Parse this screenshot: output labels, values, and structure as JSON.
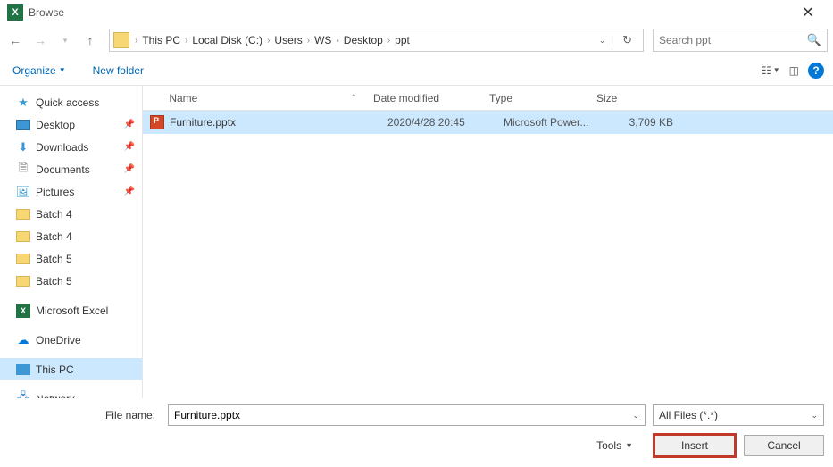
{
  "titlebar": {
    "title": "Browse"
  },
  "breadcrumb": {
    "items": [
      "This PC",
      "Local Disk (C:)",
      "Users",
      "WS",
      "Desktop",
      "ppt"
    ]
  },
  "search": {
    "placeholder": "Search ppt"
  },
  "toolbar": {
    "organize": "Organize",
    "new_folder": "New folder"
  },
  "sidebar": {
    "quick_access": "Quick access",
    "desktop": "Desktop",
    "downloads": "Downloads",
    "documents": "Documents",
    "pictures": "Pictures",
    "batch4a": "Batch 4",
    "batch4b": "Batch 4",
    "batch5a": "Batch 5",
    "batch5b": "Batch 5",
    "excel": "Microsoft Excel",
    "onedrive": "OneDrive",
    "thispc": "This PC",
    "network": "Network"
  },
  "columns": {
    "name": "Name",
    "date": "Date modified",
    "type": "Type",
    "size": "Size"
  },
  "files": [
    {
      "name": "Furniture.pptx",
      "date": "2020/4/28 20:45",
      "type": "Microsoft Power...",
      "size": "3,709 KB",
      "selected": true
    }
  ],
  "footer": {
    "filename_label": "File name:",
    "filename_value": "Furniture.pptx",
    "filter": "All Files (*.*)",
    "tools": "Tools",
    "insert": "Insert",
    "cancel": "Cancel"
  }
}
